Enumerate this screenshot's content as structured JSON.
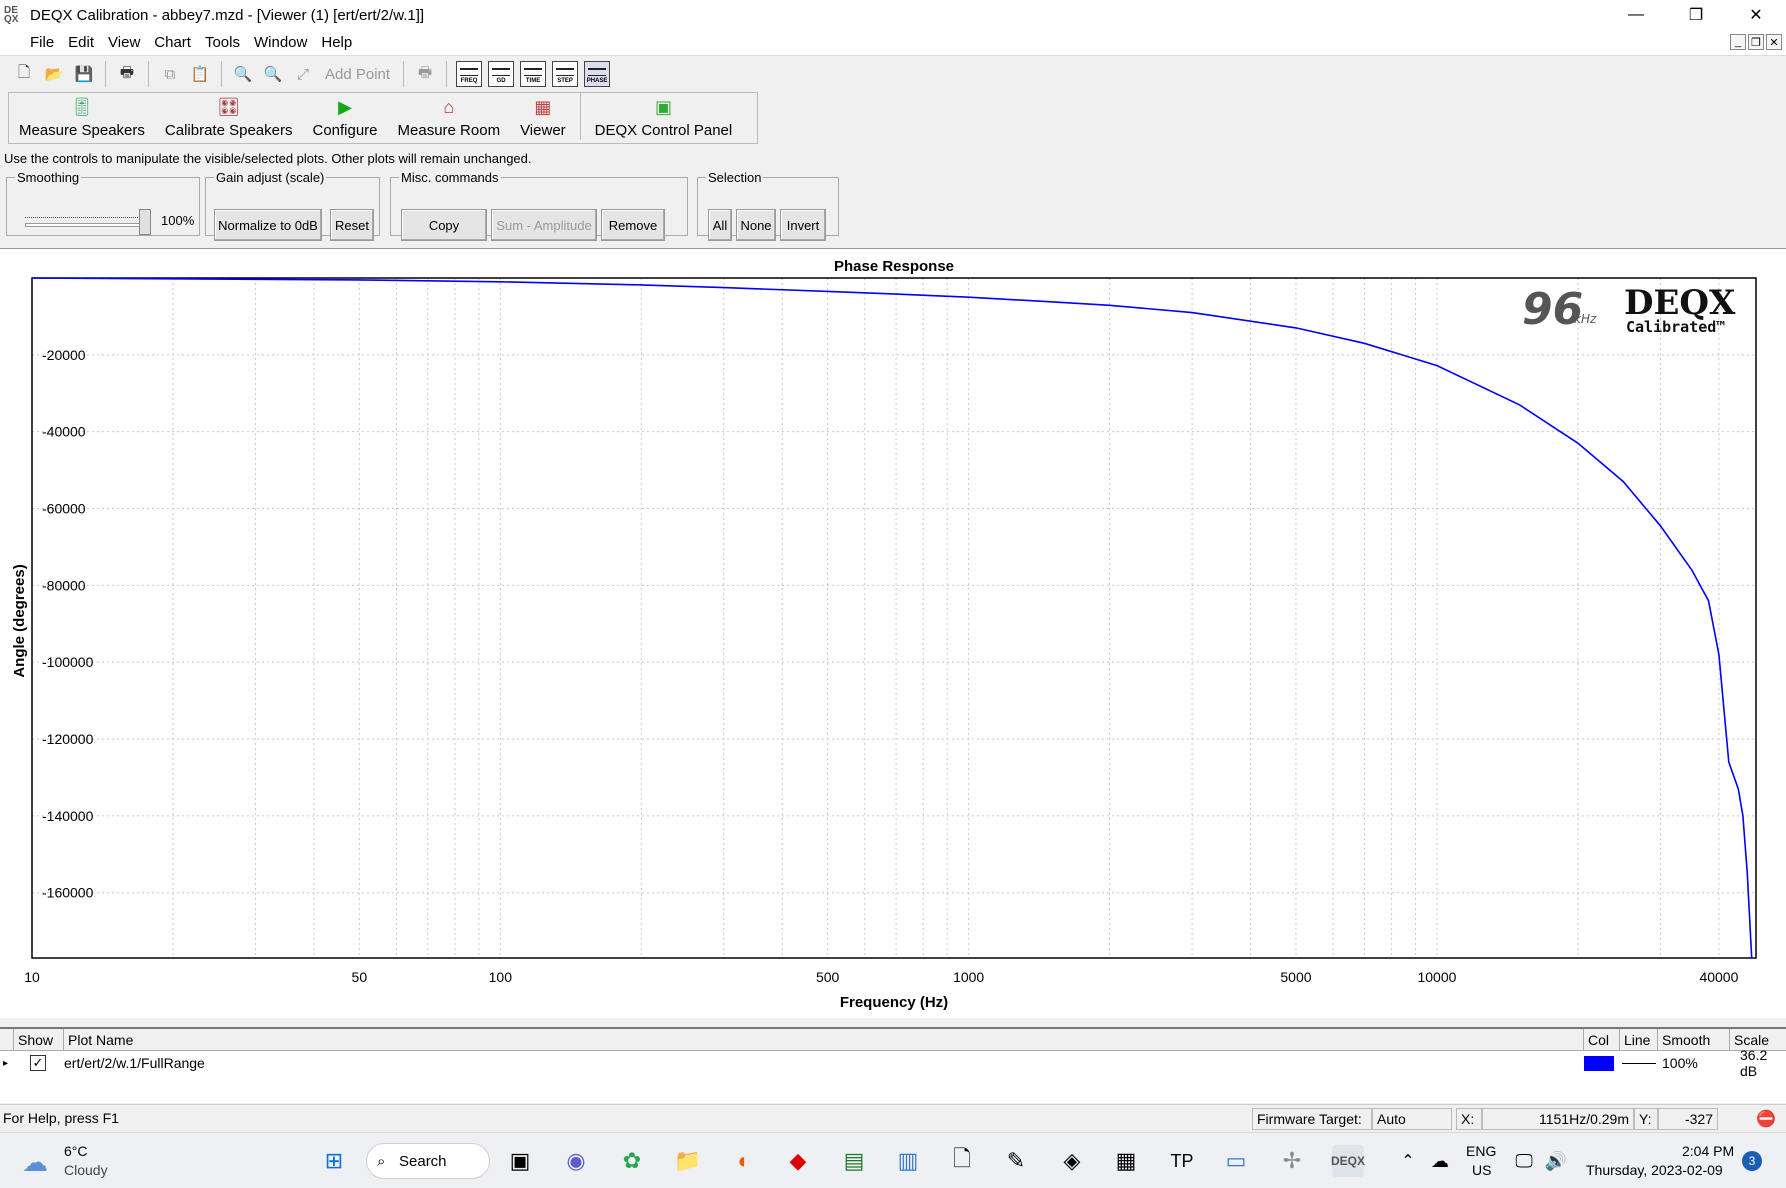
{
  "window": {
    "title": "DEQX Calibration - abbey7.mzd - [Viewer (1) [ert/ert/2/w.1]]",
    "minimize": "—",
    "restore": "❐",
    "close": "✕"
  },
  "menu": [
    "File",
    "Edit",
    "View",
    "Chart",
    "Tools",
    "Window",
    "Help"
  ],
  "toolbar1": {
    "add_point": "Add Point",
    "chart_icons": [
      "FREQ",
      "GD",
      "TIME",
      "STEP",
      "PHASE"
    ]
  },
  "toolbar2": [
    "Measure Speakers",
    "Calibrate Speakers",
    "Configure",
    "Measure Room",
    "Viewer",
    "DEQX Control Panel"
  ],
  "hint": "Use the controls to manipulate the visible/selected plots.  Other plots will remain unchanged.",
  "smoothing": {
    "legend": "Smoothing",
    "value": "100%"
  },
  "gain": {
    "legend": "Gain adjust (scale)",
    "normalize": "Normalize to 0dB",
    "reset": "Reset"
  },
  "misc": {
    "legend": "Misc. commands",
    "copy": "Copy",
    "sum": "Sum - Amplitude",
    "remove": "Remove"
  },
  "selection": {
    "legend": "Selection",
    "all": "All",
    "none": "None",
    "invert": "Invert"
  },
  "chart_data": {
    "type": "line",
    "title": "Phase Response",
    "xlabel": "Frequency (Hz)",
    "ylabel": "Angle (degrees)",
    "xscale": "log",
    "xlim": [
      10,
      48000
    ],
    "ylim": [
      -177000,
      0
    ],
    "xticks": [
      10,
      50,
      100,
      500,
      1000,
      5000,
      10000,
      40000
    ],
    "xtick_labels": [
      "10",
      "50",
      "100",
      "500",
      "1000",
      "5000",
      "10000",
      "40000"
    ],
    "yticks": [
      -20000,
      -40000,
      -60000,
      -80000,
      -100000,
      -120000,
      -140000,
      -160000
    ],
    "ytick_labels": [
      "-20000",
      "-40000",
      "-60000",
      "-80000",
      "-100000",
      "-120000",
      "-140000",
      "-160000"
    ],
    "grid": true,
    "series": [
      {
        "color": "#0000ff",
        "x": [
          10,
          20,
          50,
          100,
          200,
          300,
          500,
          700,
          1000,
          1500,
          2000,
          3000,
          5000,
          7000,
          10000,
          15000,
          20000,
          25000,
          30000,
          35000,
          38000,
          40000,
          42000,
          44000,
          45000,
          46000,
          47000
        ],
        "y": [
          0,
          -200,
          -500,
          -1000,
          -1800,
          -2500,
          -3500,
          -4200,
          -5000,
          -6200,
          -7100,
          -9000,
          -13000,
          -17000,
          -22800,
          -33000,
          -43000,
          -53000,
          -64500,
          -76000,
          -84000,
          -98000,
          -126000,
          -133000,
          -140000,
          -155000,
          -177000
        ]
      }
    ],
    "logo": {
      "rate": "96",
      "unit": "kHz",
      "brand": "DEQX",
      "sub": "Calibrated™"
    }
  },
  "plot_list": {
    "headers": [
      "Show",
      "Plot Name",
      "Col",
      "Line",
      "Smooth",
      "Scale"
    ],
    "rows": [
      {
        "name": "ert/ert/2/w.1/FullRange",
        "color": "#0000ff",
        "smooth": "100%",
        "scale": "36.2 dB"
      }
    ]
  },
  "status": {
    "help": "For Help, press F1",
    "firmware_label": "Firmware Target:",
    "firmware_value": "Auto",
    "x_label": "X:",
    "x_value": "1151Hz/0.29m",
    "y_label": "Y:",
    "y_value": "-327"
  },
  "taskbar": {
    "temp": "6°C",
    "weather": "Cloudy",
    "search": "Search",
    "lang1": "ENG",
    "lang2": "US",
    "time": "2:04 PM",
    "date": "Thursday, 2023-02-09",
    "badge": "3"
  }
}
